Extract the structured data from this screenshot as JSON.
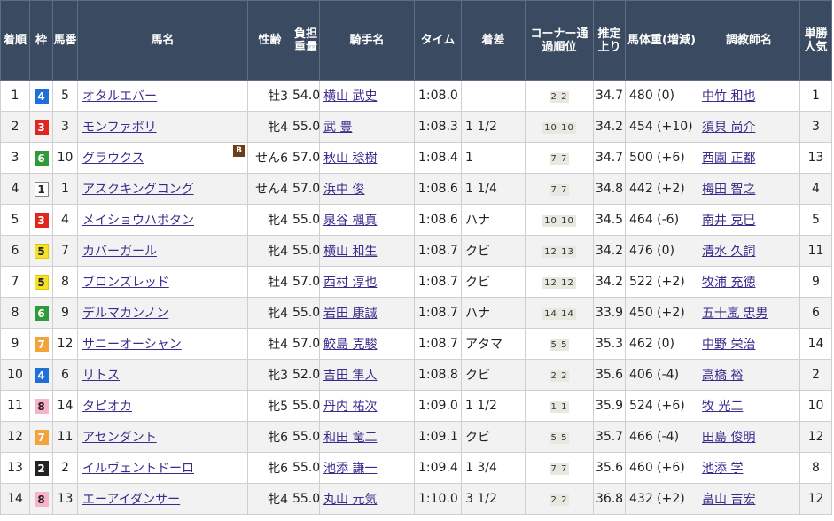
{
  "headers": {
    "rank": "着順",
    "waku": "枠",
    "umaban": "馬番",
    "horse": "馬名",
    "sexage": "性齢",
    "weight": "負担重量",
    "jockey": "騎手名",
    "time": "タイム",
    "margin": "着差",
    "corner": "コーナー通過順位",
    "last3f": "推定上り",
    "body": "馬体重(増減)",
    "trainer": "調教師名",
    "pop": "単勝人気"
  },
  "waku_colors": {
    "1": {
      "bg": "#ffffff",
      "fg": "#222222",
      "border": "#888888"
    },
    "2": {
      "bg": "#222222",
      "fg": "#ffffff",
      "border": "#222222"
    },
    "3": {
      "bg": "#e0261e",
      "fg": "#ffffff",
      "border": "#e0261e"
    },
    "4": {
      "bg": "#1e6fd9",
      "fg": "#ffffff",
      "border": "#1e6fd9"
    },
    "5": {
      "bg": "#f5e12a",
      "fg": "#222222",
      "border": "#e0c800"
    },
    "6": {
      "bg": "#2f9a3a",
      "fg": "#ffffff",
      "border": "#2f9a3a"
    },
    "7": {
      "bg": "#f4a23a",
      "fg": "#ffffff",
      "border": "#f4a23a"
    },
    "8": {
      "bg": "#f7b3c7",
      "fg": "#222222",
      "border": "#f7b3c7"
    }
  },
  "rows": [
    {
      "rank": "1",
      "waku": "4",
      "umaban": "5",
      "horse": "オタルエバー",
      "blinker": "",
      "sexage": "牡3",
      "weight": "54.0",
      "jockey": "横山 武史",
      "time": "1:08.0",
      "margin": "",
      "corner": "2 2",
      "last3f": "34.7",
      "body": "480 (0)",
      "trainer": "中竹 和也",
      "pop": "1"
    },
    {
      "rank": "2",
      "waku": "3",
      "umaban": "3",
      "horse": "モンファボリ",
      "blinker": "",
      "sexage": "牝4",
      "weight": "55.0",
      "jockey": "武 豊",
      "time": "1:08.3",
      "margin": "1 1/2",
      "corner": "10 10",
      "last3f": "34.2",
      "body": "454 (+10)",
      "trainer": "須貝 尚介",
      "pop": "3"
    },
    {
      "rank": "3",
      "waku": "6",
      "umaban": "10",
      "horse": "グラウクス",
      "blinker": "B",
      "sexage": "せん6",
      "weight": "57.0",
      "jockey": "秋山 稔樹",
      "time": "1:08.4",
      "margin": "1",
      "corner": "7 7",
      "last3f": "34.7",
      "body": "500 (+6)",
      "trainer": "西園 正都",
      "pop": "13"
    },
    {
      "rank": "4",
      "waku": "1",
      "umaban": "1",
      "horse": "アスクキングコング",
      "blinker": "",
      "sexage": "せん4",
      "weight": "57.0",
      "jockey": "浜中 俊",
      "time": "1:08.6",
      "margin": "1 1/4",
      "corner": "7 7",
      "last3f": "34.8",
      "body": "442 (+2)",
      "trainer": "梅田 智之",
      "pop": "4"
    },
    {
      "rank": "5",
      "waku": "3",
      "umaban": "4",
      "horse": "メイショウハボタン",
      "blinker": "",
      "sexage": "牝4",
      "weight": "55.0",
      "jockey": "泉谷 楓真",
      "time": "1:08.6",
      "margin": "ハナ",
      "corner": "10 10",
      "last3f": "34.5",
      "body": "464 (-6)",
      "trainer": "南井 克巳",
      "pop": "5"
    },
    {
      "rank": "6",
      "waku": "5",
      "umaban": "7",
      "horse": "カバーガール",
      "blinker": "",
      "sexage": "牝4",
      "weight": "55.0",
      "jockey": "横山 和生",
      "time": "1:08.7",
      "margin": "クビ",
      "corner": "12 13",
      "last3f": "34.2",
      "body": "476 (0)",
      "trainer": "清水 久詞",
      "pop": "11"
    },
    {
      "rank": "7",
      "waku": "5",
      "umaban": "8",
      "horse": "ブロンズレッド",
      "blinker": "",
      "sexage": "牡4",
      "weight": "57.0",
      "jockey": "西村 淳也",
      "time": "1:08.7",
      "margin": "クビ",
      "corner": "12 12",
      "last3f": "34.2",
      "body": "522 (+2)",
      "trainer": "牧浦 充徳",
      "pop": "9"
    },
    {
      "rank": "8",
      "waku": "6",
      "umaban": "9",
      "horse": "デルマカンノン",
      "blinker": "",
      "sexage": "牝4",
      "weight": "55.0",
      "jockey": "岩田 康誠",
      "time": "1:08.7",
      "margin": "ハナ",
      "corner": "14 14",
      "last3f": "33.9",
      "body": "450 (+2)",
      "trainer": "五十嵐 忠男",
      "pop": "6"
    },
    {
      "rank": "9",
      "waku": "7",
      "umaban": "12",
      "horse": "サニーオーシャン",
      "blinker": "",
      "sexage": "牡4",
      "weight": "57.0",
      "jockey": "鮫島 克駿",
      "time": "1:08.7",
      "margin": "アタマ",
      "corner": "5 5",
      "last3f": "35.3",
      "body": "462 (0)",
      "trainer": "中野 栄治",
      "pop": "14"
    },
    {
      "rank": "10",
      "waku": "4",
      "umaban": "6",
      "horse": "リトス",
      "blinker": "",
      "sexage": "牝3",
      "weight": "52.0",
      "jockey": "吉田 隼人",
      "time": "1:08.8",
      "margin": "クビ",
      "corner": "2 2",
      "last3f": "35.6",
      "body": "406 (-4)",
      "trainer": "高橋 裕",
      "pop": "2"
    },
    {
      "rank": "11",
      "waku": "8",
      "umaban": "14",
      "horse": "タピオカ",
      "blinker": "",
      "sexage": "牝5",
      "weight": "55.0",
      "jockey": "丹内 祐次",
      "time": "1:09.0",
      "margin": "1 1/2",
      "corner": "1 1",
      "last3f": "35.9",
      "body": "524 (+6)",
      "trainer": "牧 光二",
      "pop": "10"
    },
    {
      "rank": "12",
      "waku": "7",
      "umaban": "11",
      "horse": "アセンダント",
      "blinker": "",
      "sexage": "牝6",
      "weight": "55.0",
      "jockey": "和田 竜二",
      "time": "1:09.1",
      "margin": "クビ",
      "corner": "5 5",
      "last3f": "35.7",
      "body": "466 (-4)",
      "trainer": "田島 俊明",
      "pop": "12"
    },
    {
      "rank": "13",
      "waku": "2",
      "umaban": "2",
      "horse": "イルヴェントドーロ",
      "blinker": "",
      "sexage": "牝6",
      "weight": "55.0",
      "jockey": "池添 謙一",
      "time": "1:09.4",
      "margin": "1 3/4",
      "corner": "7 7",
      "last3f": "35.6",
      "body": "460 (+6)",
      "trainer": "池添 学",
      "pop": "8"
    },
    {
      "rank": "14",
      "waku": "8",
      "umaban": "13",
      "horse": "エーアイダンサー",
      "blinker": "",
      "sexage": "牝4",
      "weight": "55.0",
      "jockey": "丸山 元気",
      "time": "1:10.0",
      "margin": "3 1/2",
      "corner": "2 2",
      "last3f": "36.8",
      "body": "432 (+2)",
      "trainer": "畠山 吉宏",
      "pop": "12"
    }
  ]
}
